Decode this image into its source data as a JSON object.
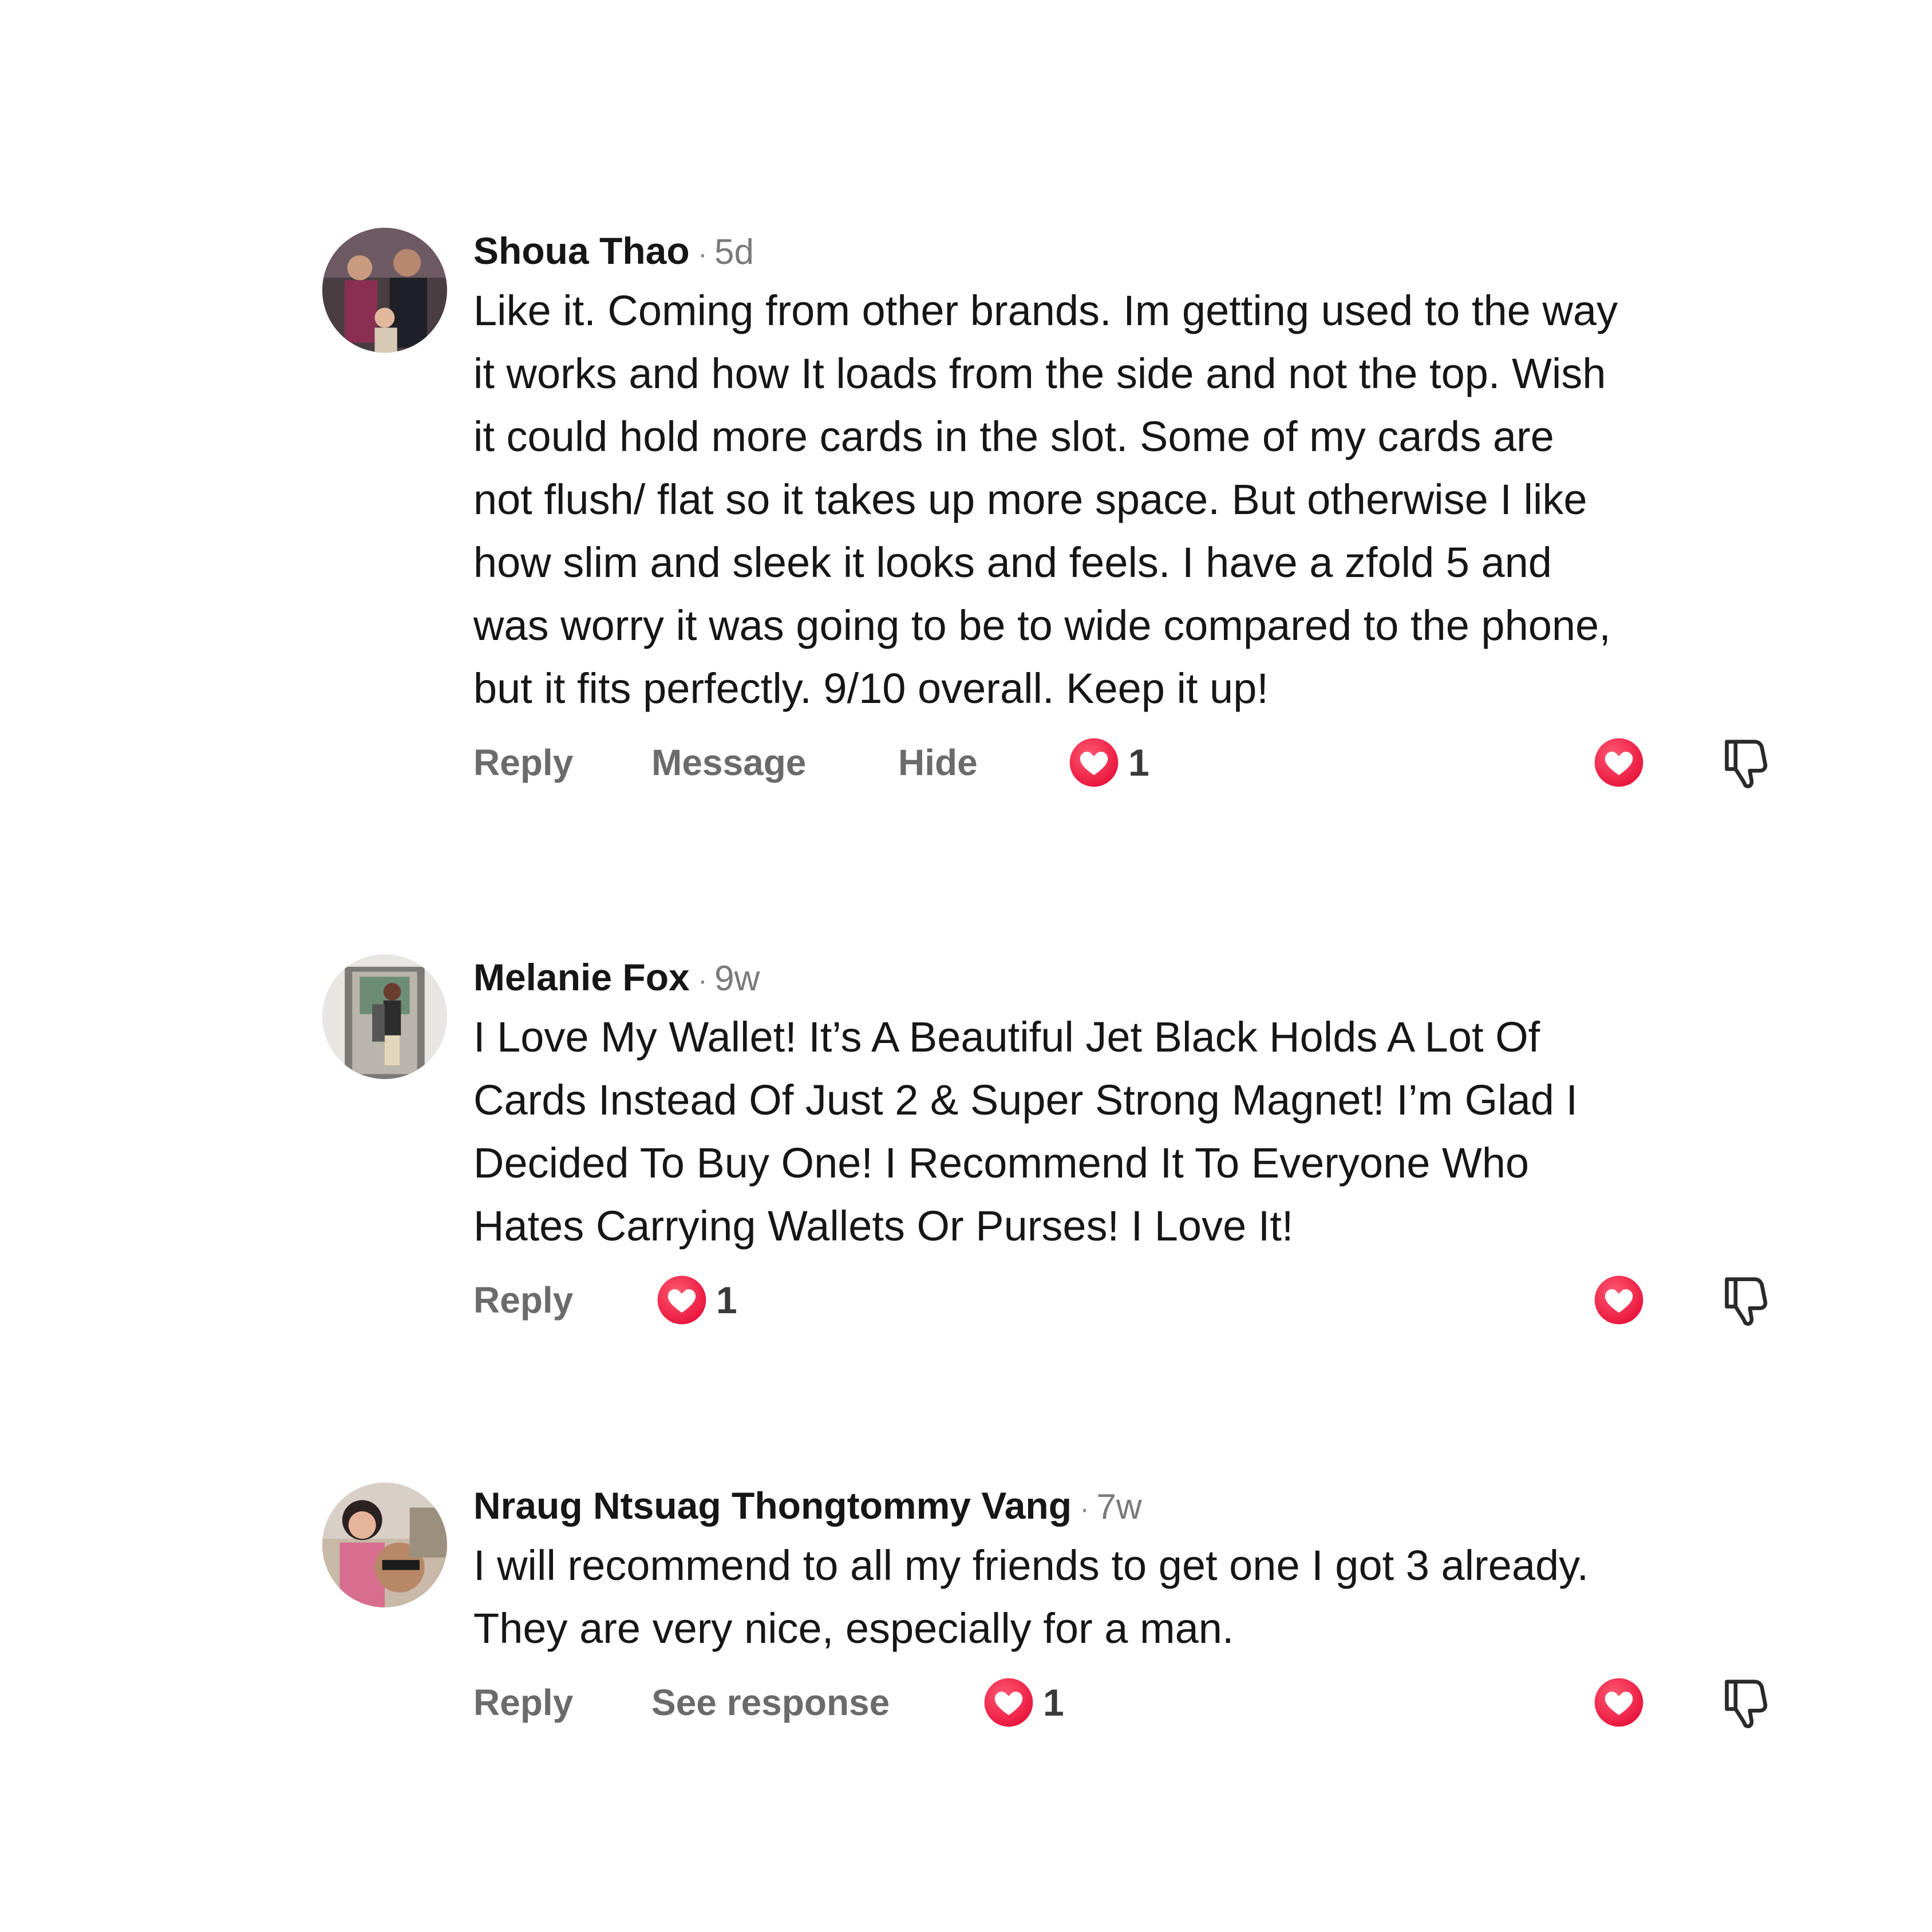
{
  "comments": [
    {
      "author": "Shoua Thao",
      "separator": "·",
      "time": "5d",
      "text": "Like it. Coming from other brands. Im getting used to the way it works and how It loads from the side and not the top. Wish it could hold more cards in the slot. Some of my cards are not flush/ flat so it takes up more space. But otherwise I like how slim and sleek it looks and feels. I have a zfold 5 and was worry it was going to be to wide compared to the phone, but it fits perfectly. 9/10 overall. Keep it up!",
      "actions": {
        "reply": "Reply",
        "message": "Message",
        "hide": "Hide"
      },
      "like_count": "1"
    },
    {
      "author": "Melanie Fox",
      "separator": "·",
      "time": "9w",
      "text": "I Love My Wallet! It’s A Beautiful Jet Black Holds A Lot Of Cards Instead Of Just 2 & Super Strong Magnet! I’m Glad I Decided To Buy One! I Recommend It To Everyone Who Hates Carrying Wallets Or Purses! I Love It!",
      "actions": {
        "reply": "Reply"
      },
      "like_count": "1"
    },
    {
      "author": "Nraug Ntsuag Thongtommy Vang",
      "separator": "·",
      "time": "7w",
      "text": "I will recommend to all my friends to get one I got 3 already. They are very nice, especially for a man.",
      "actions": {
        "reply": "Reply",
        "see_response": "See response"
      },
      "like_count": "1"
    }
  ],
  "icons": {
    "like_badge": "heart-badge-icon",
    "like_button": "heart-icon",
    "dislike_button": "thumbs-down-icon"
  },
  "colors": {
    "heart_gradient_start": "#ff3b5c",
    "heart_gradient_end": "#e8113a",
    "action_text": "#6b6b6b",
    "author_text": "#161616"
  }
}
